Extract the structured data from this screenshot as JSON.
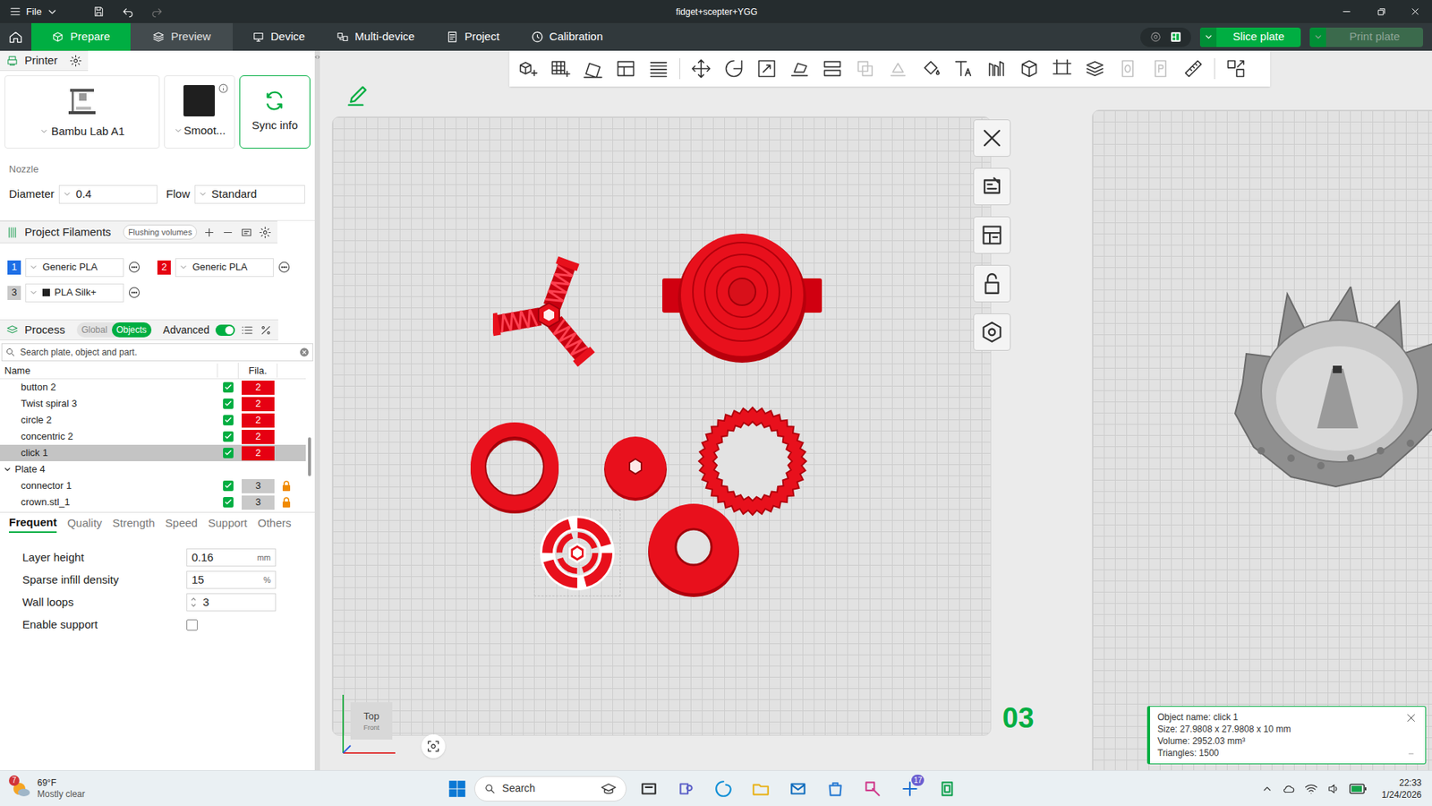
{
  "window": {
    "title": "fidget+scepter+YGG",
    "menu": "File"
  },
  "nav": {
    "tabs": [
      {
        "label": "Prepare",
        "selected": true,
        "kind": "mode"
      },
      {
        "label": "Preview",
        "selected": false,
        "kind": "mode"
      },
      {
        "label": "Device",
        "selected": false,
        "kind": "page"
      },
      {
        "label": "Multi-device",
        "selected": false,
        "kind": "page"
      },
      {
        "label": "Project",
        "selected": false,
        "kind": "page"
      },
      {
        "label": "Calibration",
        "selected": false,
        "kind": "page"
      }
    ],
    "actions": [
      {
        "label": "Slice plate",
        "disabled": false
      },
      {
        "label": "Print plate",
        "disabled": true
      }
    ]
  },
  "printer": {
    "title": "Printer",
    "model": "Bambu Lab A1",
    "plate_type": "Smoot...",
    "sync": "Sync info",
    "nozzle_label": "Nozzle",
    "diameter_label": "Diameter",
    "diameter": "0.4",
    "flow_label": "Flow",
    "flow": "Standard"
  },
  "filaments": {
    "title": "Project Filaments",
    "flushing": "Flushing volumes",
    "items": [
      {
        "index": "1",
        "name": "Generic PLA",
        "color": "#1e6fe6",
        "brand": false
      },
      {
        "index": "2",
        "name": "Generic PLA",
        "color": "#e60012",
        "brand": false
      },
      {
        "index": "3",
        "name": "PLA Silk+",
        "color": "#c9c9c9",
        "brand": true
      }
    ]
  },
  "process": {
    "title": "Process",
    "modes": [
      {
        "label": "Global",
        "selected": false
      },
      {
        "label": "Objects",
        "selected": true
      }
    ],
    "advanced_label": "Advanced",
    "advanced": true,
    "search_placeholder": "Search plate, object and part."
  },
  "object_list": {
    "columns": [
      "Name",
      "Fila."
    ],
    "rows": [
      {
        "kind": "object",
        "name": "button 2",
        "checked": true,
        "filament": "2",
        "locked": false,
        "selected": false
      },
      {
        "kind": "object",
        "name": "Twist spiral 3",
        "checked": true,
        "filament": "2",
        "locked": false,
        "selected": false
      },
      {
        "kind": "object",
        "name": "circle 2",
        "checked": true,
        "filament": "2",
        "locked": false,
        "selected": false
      },
      {
        "kind": "object",
        "name": "concentric 2",
        "checked": true,
        "filament": "2",
        "locked": false,
        "selected": false
      },
      {
        "kind": "object",
        "name": "click 1",
        "checked": true,
        "filament": "2",
        "locked": false,
        "selected": true
      },
      {
        "kind": "plate",
        "name": "Plate 4",
        "expanded": true,
        "selected": false
      },
      {
        "kind": "object",
        "name": "connector 1",
        "checked": true,
        "filament": "3",
        "locked": true,
        "selected": false
      },
      {
        "kind": "object",
        "name": "crown.stl_1",
        "checked": true,
        "filament": "3",
        "locked": true,
        "selected": false
      }
    ]
  },
  "settings": {
    "tabs": [
      {
        "label": "Frequent",
        "selected": true
      },
      {
        "label": "Quality",
        "selected": false
      },
      {
        "label": "Strength",
        "selected": false
      },
      {
        "label": "Speed",
        "selected": false
      },
      {
        "label": "Support",
        "selected": false
      },
      {
        "label": "Others",
        "selected": false
      }
    ],
    "rows": [
      {
        "kind": "number",
        "label": "Layer height",
        "value": "0.16",
        "unit": "mm"
      },
      {
        "kind": "number",
        "label": "Sparse infill density",
        "value": "15",
        "unit": "%"
      },
      {
        "kind": "spin",
        "label": "Wall loops",
        "value": "3"
      },
      {
        "kind": "checkbox",
        "label": "Enable support",
        "checked": false
      }
    ]
  },
  "canvas": {
    "plate_number": "03",
    "view_label": "Top",
    "view_sub": "Front",
    "objects": [
      {
        "kind": "spiral",
        "selected": false
      },
      {
        "kind": "button",
        "selected": false
      },
      {
        "kind": "ring",
        "selected": false
      },
      {
        "kind": "cone",
        "selected": false
      },
      {
        "kind": "gear",
        "selected": false
      },
      {
        "kind": "click",
        "selected": true
      },
      {
        "kind": "donut",
        "selected": false
      }
    ]
  },
  "info": {
    "lines": [
      "Object name: click 1",
      "Size: 27.9808 x 27.9808 x 10 mm",
      "Volume: 2952.03 mm³",
      "Triangles: 1500"
    ]
  },
  "taskbar": {
    "weather_badge": "7",
    "temperature": "69°F",
    "condition": "Mostly clear",
    "search": "Search",
    "app_badge": "17",
    "time": "22:33",
    "date": "1/24/2026"
  }
}
